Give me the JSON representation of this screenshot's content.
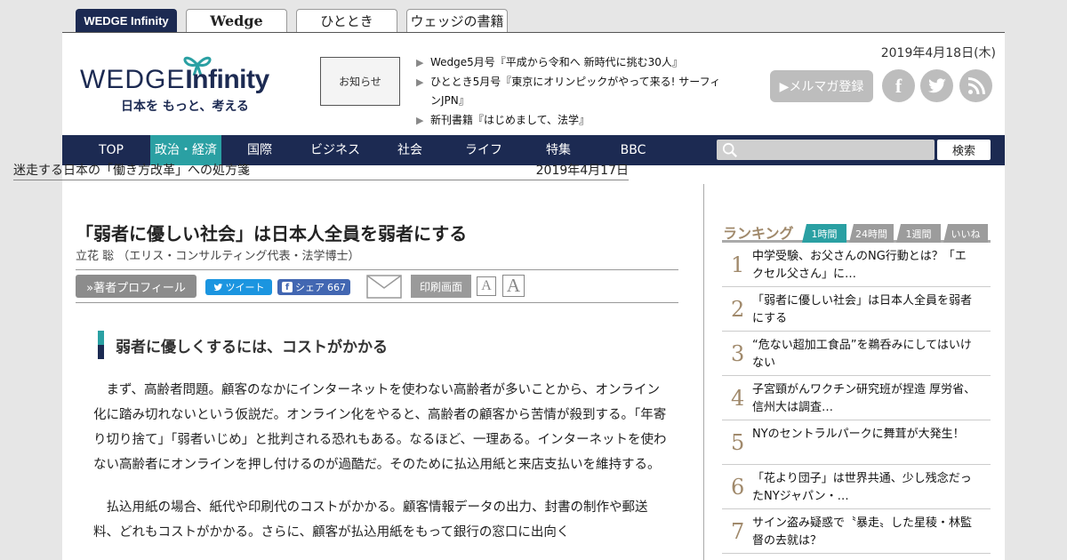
{
  "site_tabs": [
    {
      "label": "WEDGE Infinity"
    },
    {
      "label": "Wedge"
    },
    {
      "label": "ひととき"
    },
    {
      "label": "ウェッジの書籍"
    }
  ],
  "header": {
    "logo_title_a": "WEDGE",
    "logo_title_b": "Infinity",
    "logo_tagline": "日本を もっと、考える",
    "notice_label": "お知らせ",
    "news": [
      "Wedge5月号『平成から令和へ 新時代に挑む30人』",
      "ひととき5月号『東京にオリンピックがやって来る! サーフィンJPN』",
      "新刊書籍『はじめまして、法学』"
    ],
    "date": "2019年4月18日(木)",
    "mailmag_label": "▶メルマガ登録",
    "social": [
      "facebook-icon",
      "twitter-icon",
      "rss-icon"
    ]
  },
  "nav": {
    "items": [
      "TOP",
      "政治・経済",
      "国際",
      "ビジネス",
      "社会",
      "ライフ",
      "特集",
      "BBC"
    ],
    "active_index": 1,
    "search_placeholder": "",
    "search_button": "検索"
  },
  "article": {
    "series": "迷走する日本の「働き方改革」への処方箋",
    "date": "2019年4月17日",
    "title": "「弱者に優しい社会」は日本人全員を弱者にする",
    "author": "立花 聡 （エリス・コンサルティング代表・法学博士）",
    "profile_button": "»著者プロフィール",
    "tweet_label": "ツイート",
    "share_label": "シェア",
    "share_count": "667",
    "print_label": "印刷画面",
    "font_small": "A",
    "font_large": "A",
    "section_heading": "弱者に優しくするには、コストがかかる",
    "paragraphs": [
      "まず、高齢者問題。顧客のなかにインターネットを使わない高齢者が多いことから、オンライン化に踏み切れないという仮説だ。オンライン化をやると、高齢者の顧客から苦情が殺到する。「年寄り切り捨て」「弱者いじめ」と批判される恐れもある。なるほど、一理ある。インターネットを使わない高齢者にオンラインを押し付けるのが過酷だ。そのために払込用紙と来店支払いを維持する。",
      "払込用紙の場合、紙代や印刷代のコストがかかる。顧客情報データの出力、封書の制作や郵送料、どれもコストがかかる。さらに、顧客が払込用紙をもって銀行の窓口に出向く"
    ]
  },
  "ranking": {
    "title": "ランキング",
    "tabs": [
      "1時間",
      "24時間",
      "1週間",
      "いいね"
    ],
    "active_tab": 0,
    "items": [
      {
        "num": "1",
        "text": "中学受験、お父さんのNG行動とは？「エクセル父さん」に…"
      },
      {
        "num": "2",
        "text": "「弱者に優しい社会」は日本人全員を弱者にする"
      },
      {
        "num": "3",
        "text": "“危ない超加工食品”を鵜呑みにしてはいけない"
      },
      {
        "num": "4",
        "text": "子宮頸がんワクチン研究班が捏造 厚労省、信州大は調査…"
      },
      {
        "num": "5",
        "text": "NYのセントラルパークに舞茸が大発生！"
      },
      {
        "num": "6",
        "text": "「花より団子」は世界共通、少し残念だったNYジャパン・…"
      },
      {
        "num": "7",
        "text": "サイン盗み疑惑で〝暴走〟した星稜・林監督の去就は？"
      }
    ]
  },
  "colors": {
    "navy": "#1c2a52",
    "teal": "#2aa0a3",
    "rank_brown": "#a0896b",
    "twitter": "#1b95e0",
    "facebook": "#4267b2"
  }
}
